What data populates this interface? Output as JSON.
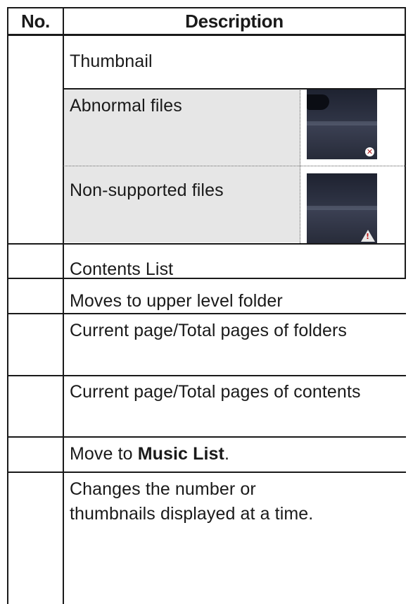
{
  "table": {
    "headers": {
      "no": "No.",
      "description": "Description"
    },
    "rows": [
      {
        "no": "",
        "description": "Thumbnail"
      },
      {
        "no": "",
        "description": "Abnormal files",
        "icon": "error-badge"
      },
      {
        "no": "",
        "description": "Non-supported files",
        "icon": "warning-badge"
      },
      {
        "no": "",
        "description": "Contents List"
      },
      {
        "no": "",
        "description": "Moves to upper level folder"
      },
      {
        "no": "",
        "description": "Current page/Total pages of folders"
      },
      {
        "no": "",
        "description": "Current page/Total pages of contents"
      },
      {
        "no": "",
        "description_prefix": "Move to ",
        "description_bold": "Music List",
        "description_suffix": "."
      },
      {
        "no": "",
        "description": "Changes the number or thumbnails displayed at a time."
      }
    ]
  }
}
